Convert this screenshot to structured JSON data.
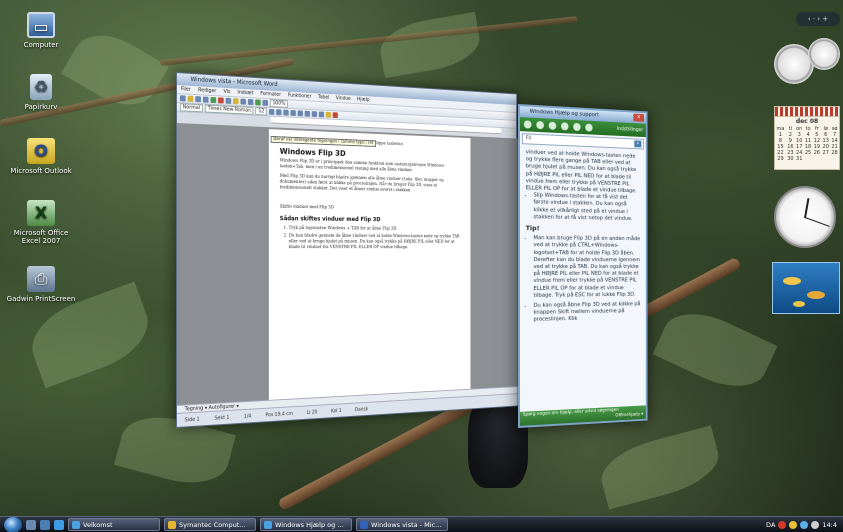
{
  "desktop": {
    "icons": [
      {
        "label": "Computer"
      },
      {
        "label": "Papirkurv"
      },
      {
        "label": "Microsoft Outlook"
      },
      {
        "label": "Microsoft Office Excel 2007"
      },
      {
        "label": "Gadwin PrintScreen"
      }
    ]
  },
  "word": {
    "title": "Windows vista - Microsoft Word",
    "menu": [
      "Filer",
      "Rediger",
      "Vis",
      "Indsæt",
      "Formater",
      "Funktioner",
      "Tabel",
      "Vindue",
      "Hjælp"
    ],
    "font_style": "Normal",
    "font_name": "Times New Roman",
    "font_size": "12",
    "zoom": "100%",
    "tooltip": "Deraf var intelligente tegningen i samme type i ret",
    "doc": {
      "intro": "Når du ser det vindue, der skal bruges, skal du slippe tasterne.",
      "heading1": "Windows Flip 3D",
      "para1": "Windows Flip 3D er i princippet den samme funktion som tastaturgenvejen Windows-tasten+Tab, men i en tredimensionel visning med alle åbne vinduer.",
      "para2": "Med Flip 3D kan du hurtigt bladre igennem alle åbne vinduer (f.eks. filer, mapper og dokumenter) uden først at klikke på proceslinjen. Når du bruger Flip 3D, vises et tredimensionelt stakket. Det viser et åbent vindue øverst i stakken.",
      "caption": "Skifte vinduet med Flip 3D",
      "heading2": "Sådan skiftes vinduer med Flip 3D",
      "steps": [
        "Tryk på logotasten Windows + TAB for at åbne Flip 3D.",
        "Du kan bladre gennem de åbne vinduer ved at holde Windows-tasten nede og trykke TAB eller ved at bruge hjulet på musen. Du kan også trykke på HØJRE PIL eller NED for at blade til vinduet fra VENSTRE PIL ELLER OP vindue tilbage."
      ]
    },
    "status": [
      "Side 1",
      "Sekt 1",
      "1/4",
      "Pos 19,4 cm",
      "Li 20",
      "Kol 1",
      "Dansk"
    ],
    "drawbar": "Tegning ▾   Autofigurer ▾"
  },
  "help": {
    "title": "Windows Hjælp og support",
    "options_label": "Indstillinger",
    "search_placeholder": "Fli",
    "para1": "vinduer ved at holde Windows-tasten nede og trykke flere gange på TAB eller ved at bruge hjulet på musen. Du kan også trykke på HØJRE PIL eller PIL NED for at blade til vindue frem eller trykke på VENSTRE PIL ELLER PIL OP for at blade et vindue tilbage.",
    "bullet1": "Slip Windows-tasten for at få vist det første vindue i stakken. Du kan også klikke et vilkårligt sted på et vindue i stakken for at få vist netop det vindue.",
    "tip_heading": "Tip!",
    "tips": [
      "Man kan bruge Flip 3D på en anden måde ved at trykke på CTRL+Windows-logotast+TAB for at holde Flip 3D åben. Derefter kan du blade vinduerne igennem ved at trykke på TAB. Du kan også trykke på HØJRE PIL eller PIL NED for at blade et vindue frem eller trykke på VENSTRE PIL ELLER PIL OP for at blade et vindue tilbage. Tryk på ESC for at lukke Flip 3D.",
      "Du kan også åbne Flip 3D ved at klikke på knappen Skift mellem vinduerne på proceslinjen. Klik"
    ],
    "footer": "Spørg nogen om hjælp, eller udvid søgningen",
    "footer2": "Offlinehjælp ▾"
  },
  "calendar": {
    "month": "dec 08",
    "days": [
      "ma",
      "ti",
      "on",
      "to",
      "fr",
      "lø",
      "sø"
    ],
    "weeks": [
      [
        "1",
        "2",
        "3",
        "4",
        "5",
        "6",
        "7"
      ],
      [
        "8",
        "9",
        "10",
        "11",
        "12",
        "13",
        "14"
      ],
      [
        "15",
        "16",
        "17",
        "18",
        "19",
        "20",
        "21"
      ],
      [
        "22",
        "23",
        "24",
        "25",
        "26",
        "27",
        "28"
      ],
      [
        "29",
        "30",
        "31",
        "",
        "",
        "",
        ""
      ]
    ]
  },
  "taskbar": {
    "tasks": [
      {
        "label": "Velkomst",
        "color": "#4aa3df"
      },
      {
        "label": "Symantec Comput...",
        "color": "#e3b531"
      },
      {
        "label": "Windows Hjælp og ...",
        "color": "#4aa3df"
      },
      {
        "label": "Windows vista - Mic...",
        "color": "#2f63b8"
      }
    ],
    "lang": "DA",
    "time": "14:4"
  }
}
